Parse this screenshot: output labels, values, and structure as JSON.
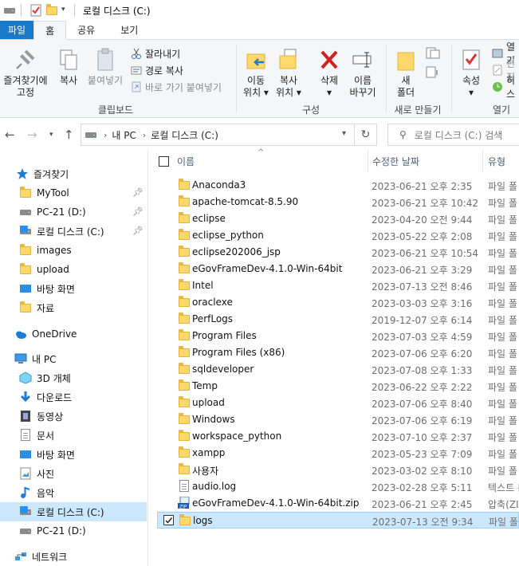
{
  "window": {
    "title": "로컬 디스크 (C:)"
  },
  "tabs": [
    {
      "label": "파일"
    },
    {
      "label": "홈"
    },
    {
      "label": "공유"
    },
    {
      "label": "보기"
    }
  ],
  "ribbon": {
    "clipboard": {
      "pin_quick_access": [
        "즐겨찾기에",
        "고정"
      ],
      "copy": "복사",
      "paste": "붙여넣기",
      "cut": "잘라내기",
      "copy_path": "경로 복사",
      "paste_shortcut": "바로 가기 붙여넣기",
      "group_label": "클립보드"
    },
    "organize": {
      "move_to": [
        "이동",
        "위치 ▾"
      ],
      "copy_to": [
        "복사",
        "위치 ▾"
      ],
      "delete": [
        "삭제",
        "▾"
      ],
      "rename": [
        "이름",
        "바꾸기"
      ],
      "group_label": "구성"
    },
    "new": {
      "new_folder": [
        "새",
        "폴더"
      ],
      "group_label": "새로 만들기"
    },
    "open": {
      "properties": [
        "속성",
        "▾"
      ],
      "open_label": "열기",
      "edit_label": "편집",
      "history_label": "히스",
      "group_label": "열기"
    }
  },
  "address": {
    "crumbs": [
      "내 PC",
      "로컬 디스크 (C:)"
    ],
    "search_placeholder": "로컬 디스크 (C:) 검색"
  },
  "nav_pane": {
    "quick_access_label": "즐겨찾기",
    "quick_items": [
      {
        "label": "MyTool",
        "pinned": true
      },
      {
        "label": "PC-21 (D:)",
        "pinned": true
      },
      {
        "label": "로컬 디스크 (C:)",
        "pinned": true
      },
      {
        "label": "images",
        "pinned": false
      },
      {
        "label": "upload",
        "pinned": false
      },
      {
        "label": "바탕 화면",
        "pinned": false
      },
      {
        "label": "자료",
        "pinned": false
      }
    ],
    "onedrive_label": "OneDrive",
    "thispc_label": "내 PC",
    "pc_items": [
      {
        "label": "3D 개체"
      },
      {
        "label": "다운로드"
      },
      {
        "label": "동영상"
      },
      {
        "label": "문서"
      },
      {
        "label": "바탕 화면"
      },
      {
        "label": "사진"
      },
      {
        "label": "음악"
      },
      {
        "label": "로컬 디스크 (C:)"
      },
      {
        "label": "PC-21 (D:)"
      }
    ],
    "network_label": "네트워크"
  },
  "columns": {
    "name": "이름",
    "date": "수정한 날짜",
    "type": "유형"
  },
  "files": [
    {
      "name": "Anaconda3",
      "date": "2023-06-21 오후 2:35",
      "type": "파일 폴",
      "kind": "folder"
    },
    {
      "name": "apache-tomcat-8.5.90",
      "date": "2023-06-21 오후 10:42",
      "type": "파일 폴",
      "kind": "folder"
    },
    {
      "name": "eclipse",
      "date": "2023-04-20 오전 9:44",
      "type": "파일 폴",
      "kind": "folder"
    },
    {
      "name": "eclipse_python",
      "date": "2023-05-22 오후 2:08",
      "type": "파일 폴",
      "kind": "folder"
    },
    {
      "name": "eclipse202006_jsp",
      "date": "2023-06-21 오후 10:54",
      "type": "파일 폴",
      "kind": "folder"
    },
    {
      "name": "eGovFrameDev-4.1.0-Win-64bit",
      "date": "2023-06-21 오후 3:29",
      "type": "파일 폴",
      "kind": "folder"
    },
    {
      "name": "Intel",
      "date": "2023-07-13 오전 8:46",
      "type": "파일 폴",
      "kind": "folder"
    },
    {
      "name": "oraclexe",
      "date": "2023-03-03 오후 3:16",
      "type": "파일 폴",
      "kind": "folder"
    },
    {
      "name": "PerfLogs",
      "date": "2019-12-07 오후 6:14",
      "type": "파일 폴",
      "kind": "folder"
    },
    {
      "name": "Program Files",
      "date": "2023-07-03 오후 4:59",
      "type": "파일 폴",
      "kind": "folder"
    },
    {
      "name": "Program Files (x86)",
      "date": "2023-07-06 오후 6:20",
      "type": "파일 폴",
      "kind": "folder"
    },
    {
      "name": "sqldeveloper",
      "date": "2023-07-08 오후 1:33",
      "type": "파일 폴",
      "kind": "folder"
    },
    {
      "name": "Temp",
      "date": "2023-06-22 오후 2:22",
      "type": "파일 폴",
      "kind": "folder"
    },
    {
      "name": "upload",
      "date": "2023-07-06 오후 8:40",
      "type": "파일 폴",
      "kind": "folder"
    },
    {
      "name": "Windows",
      "date": "2023-07-06 오후 6:19",
      "type": "파일 폴",
      "kind": "folder"
    },
    {
      "name": "workspace_python",
      "date": "2023-07-10 오후 2:37",
      "type": "파일 폴",
      "kind": "folder"
    },
    {
      "name": "xampp",
      "date": "2023-05-23 오후 7:09",
      "type": "파일 폴",
      "kind": "folder"
    },
    {
      "name": "사용자",
      "date": "2023-03-02 오후 8:10",
      "type": "파일 폴",
      "kind": "folder"
    },
    {
      "name": "audio.log",
      "date": "2023-02-28 오후 5:11",
      "type": "텍스트 든",
      "kind": "doc"
    },
    {
      "name": "eGovFrameDev-4.1.0-Win-64bit.zip",
      "date": "2023-06-21 오후 2:45",
      "type": "압축(ZIP",
      "kind": "zip"
    },
    {
      "name": "logs",
      "date": "2023-07-13 오전 9:34",
      "type": "파일 폴",
      "kind": "folder",
      "selected": true
    }
  ],
  "colors": {
    "accent": "#1979ca",
    "selection": "#cce8ff",
    "folder": "#ffd86b"
  }
}
